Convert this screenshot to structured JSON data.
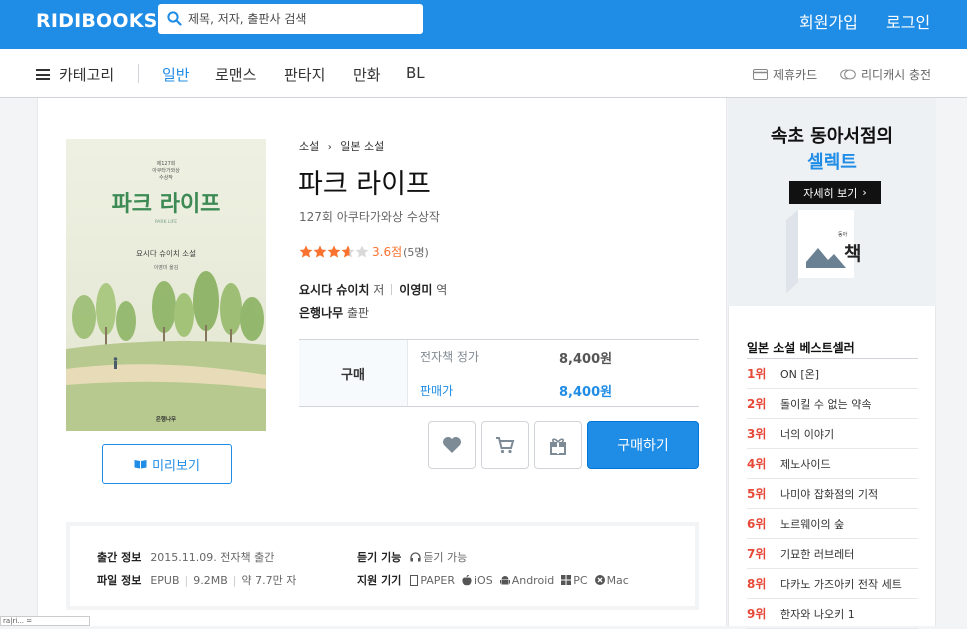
{
  "header": {
    "logo": "RIDIBOOKS",
    "search_placeholder": "제목, 저자, 출판사 검색",
    "signup": "회원가입",
    "login": "로그인"
  },
  "nav": {
    "category": "카테고리",
    "genres": [
      "일반",
      "로맨스",
      "판타지",
      "만화",
      "BL"
    ],
    "active_genre": "일반",
    "partner_card": "제휴카드",
    "ridicash": "리디캐시 충전"
  },
  "book": {
    "breadcrumb": [
      "소설",
      "일본 소설"
    ],
    "title": "파크 라이프",
    "subtitle": "127회 아쿠타가와상 수상작",
    "rating": 3.6,
    "rating_text": "3.6점",
    "rating_count": "(5명)",
    "author": "요시다 슈이치",
    "author_role": "저",
    "translator": "이영미",
    "translator_role": "역",
    "publisher": "은행나무",
    "publisher_role": "출판",
    "cover_title": "파크 라이프",
    "cover_author": "요시다 슈이치 소설",
    "cover_translator": "이영미 옮김",
    "cover_award": "제127회\n아쿠타가와상\n수상작",
    "cover_publisher": "은행나무",
    "preview_label": "미리보기"
  },
  "price": {
    "buy_label": "구매",
    "list_label": "전자책 정가",
    "list_value": "8,400원",
    "sale_label": "판매가",
    "sale_value": "8,400원",
    "purchase_button": "구매하기"
  },
  "meta": {
    "pub_key": "출간 정보",
    "pub_date": "2015.11.09.",
    "pub_note": "전자책 출간",
    "file_key": "파일 정보",
    "file_format": "EPUB",
    "file_size": "9.2MB",
    "file_chars": "약 7.7만 자",
    "listen_key": "듣기 기능",
    "listen_val": "듣기 가능",
    "support_key": "지원 기기",
    "devices": [
      "PAPER",
      "iOS",
      "Android",
      "PC",
      "Mac"
    ]
  },
  "sidebar": {
    "banner_line1": "속초 동아서점의",
    "banner_line2": "셀렉트",
    "banner_button": "자세히 보기",
    "banner_sign": "책",
    "bestseller_title": "일본 소설 베스트셀러",
    "bestsellers": [
      {
        "rank": "1위",
        "title": "ON [온]"
      },
      {
        "rank": "2위",
        "title": "돌이킬 수 없는 약속"
      },
      {
        "rank": "3위",
        "title": "너의 이야기"
      },
      {
        "rank": "4위",
        "title": "제노사이드"
      },
      {
        "rank": "5위",
        "title": "나미야 잡화점의 기적"
      },
      {
        "rank": "6위",
        "title": "노르웨이의 숲"
      },
      {
        "rank": "7위",
        "title": "기묘한 러브레터"
      },
      {
        "rank": "8위",
        "title": "다카노 가즈아키 전작 세트"
      },
      {
        "rank": "9위",
        "title": "한자와 나오키 1"
      }
    ]
  },
  "colors": {
    "brand": "#1f8ce6",
    "star": "#fa722e",
    "rank": "#e64938"
  }
}
